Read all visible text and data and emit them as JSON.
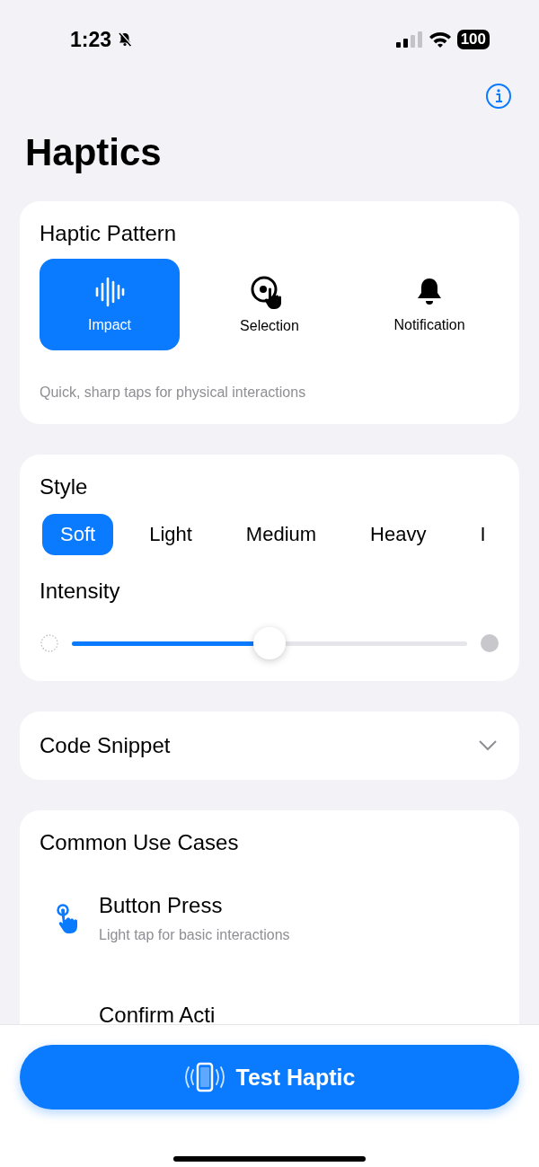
{
  "status_bar": {
    "time": "1:23",
    "battery": "100"
  },
  "title": "Haptics",
  "pattern_card": {
    "heading": "Haptic Pattern",
    "patterns": [
      {
        "label": "Impact",
        "kind": "impact",
        "selected": true
      },
      {
        "label": "Selection",
        "kind": "selection",
        "selected": false
      },
      {
        "label": "Notification",
        "kind": "notification",
        "selected": false
      }
    ],
    "description": "Quick, sharp taps for physical interactions"
  },
  "style_card": {
    "heading": "Style",
    "styles": [
      {
        "label": "Soft",
        "selected": true
      },
      {
        "label": "Light",
        "selected": false
      },
      {
        "label": "Medium",
        "selected": false
      },
      {
        "label": "Heavy",
        "selected": false
      },
      {
        "label": "I",
        "selected": false
      }
    ],
    "intensity_label": "Intensity",
    "intensity": {
      "level": 0.5
    }
  },
  "code_snippet": {
    "title": "Code Snippet",
    "expanded": false
  },
  "use_cases": {
    "heading": "Common Use Cases",
    "items": [
      {
        "title": "Button Press",
        "subtitle": "Light tap for basic interactions"
      },
      {
        "title": "Confirm Acti"
      }
    ]
  },
  "test_button": {
    "label": "Test Haptic"
  }
}
